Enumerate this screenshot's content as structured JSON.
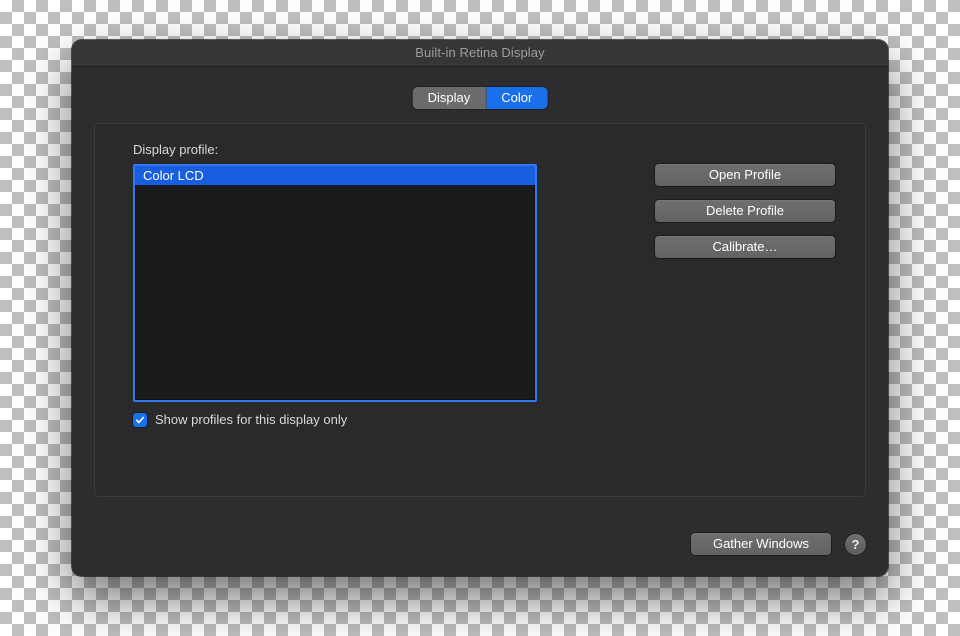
{
  "window": {
    "title": "Built-in Retina Display"
  },
  "tabs": {
    "display": "Display",
    "color": "Color",
    "active": "color"
  },
  "panel": {
    "profile_label": "Display profile:",
    "profiles": [
      {
        "name": "Color LCD",
        "selected": true
      }
    ],
    "buttons": {
      "open": "Open Profile",
      "delete": "Delete Profile",
      "calibrate": "Calibrate…"
    },
    "checkbox": {
      "checked": true,
      "label": "Show profiles for this display only"
    }
  },
  "footer": {
    "gather": "Gather Windows",
    "help": "?"
  },
  "colors": {
    "accent": "#1a6fea"
  }
}
